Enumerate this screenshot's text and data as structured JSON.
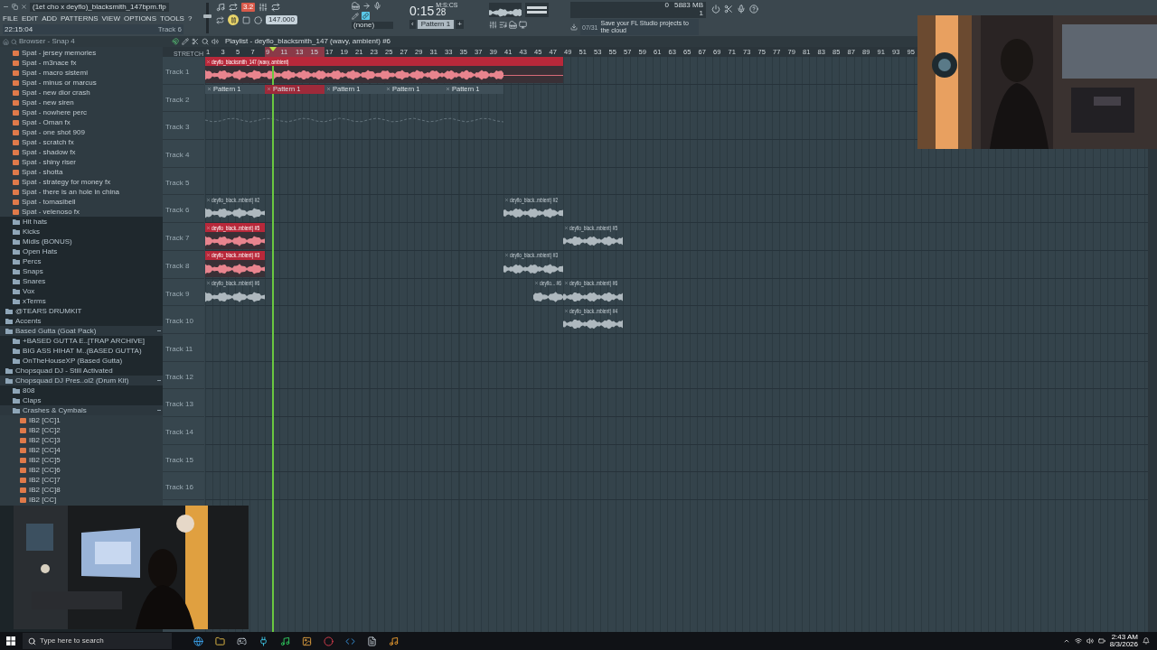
{
  "title_bar": {
    "project": "(1et cho x deyflo)_blacksmith_147bpm.flp",
    "menu": [
      "FILE",
      "EDIT",
      "ADD",
      "PATTERNS",
      "VIEW",
      "OPTIONS",
      "TOOLS",
      "?"
    ],
    "clock": "22:15:04",
    "hint": "Track 6"
  },
  "master_volume": {
    "level": 0.55
  },
  "transport": {
    "count_in": "3.2",
    "tempo": "147.000",
    "playing": true,
    "snap": "(none)"
  },
  "time_display": {
    "time": "0:15",
    "centis": "28",
    "unit": "M:S:CS"
  },
  "pattern_selector": {
    "prev": "‹",
    "label": "Pattern 1",
    "add": "+"
  },
  "monitor": {
    "cpu": "0",
    "memory": "5883 MB",
    "voices": "1"
  },
  "news": {
    "date": "07/31",
    "message": "Save your FL Studio projects to the cloud"
  },
  "browser": {
    "title": "Browser - Snap 4",
    "items": [
      {
        "kind": "file",
        "name": "Spat - jersey memories"
      },
      {
        "kind": "file",
        "name": "Spat - m3nace fx"
      },
      {
        "kind": "file",
        "name": "Spat - macro sistemi"
      },
      {
        "kind": "file",
        "name": "Spat - minus or marcus"
      },
      {
        "kind": "file",
        "name": "Spat - new dior crash"
      },
      {
        "kind": "file",
        "name": "Spat - new siren"
      },
      {
        "kind": "file",
        "name": "Spat - nowhere perc"
      },
      {
        "kind": "file",
        "name": "Spat - Oman fx"
      },
      {
        "kind": "file",
        "name": "Spat - one shot 909"
      },
      {
        "kind": "file",
        "name": "Spat - scratch fx"
      },
      {
        "kind": "file",
        "name": "Spat - shadow fx"
      },
      {
        "kind": "file",
        "name": "Spat - shiny riser"
      },
      {
        "kind": "file",
        "name": "Spat - shotta"
      },
      {
        "kind": "file",
        "name": "Spat - strategy for money fx"
      },
      {
        "kind": "file",
        "name": "Spat - there is an hole in china"
      },
      {
        "kind": "file",
        "name": "Spat - tomasibell"
      },
      {
        "kind": "file",
        "name": "Spat - velenoso fx"
      },
      {
        "kind": "folder",
        "name": "Hit hats",
        "expanded": false
      },
      {
        "kind": "folder",
        "name": "Kicks",
        "expanded": false
      },
      {
        "kind": "folder",
        "name": "Midis (BONUS)",
        "expanded": false
      },
      {
        "kind": "folder",
        "name": "Open Hats",
        "expanded": false
      },
      {
        "kind": "folder",
        "name": "Percs",
        "expanded": false
      },
      {
        "kind": "folder",
        "name": "Snaps",
        "expanded": false
      },
      {
        "kind": "folder",
        "name": "Snares",
        "expanded": false
      },
      {
        "kind": "folder",
        "name": "Vox",
        "expanded": false
      },
      {
        "kind": "folder",
        "name": "xTerms",
        "expanded": false
      }
    ],
    "tree": [
      {
        "kind": "folder",
        "name": "@TEARS DRUMKIT",
        "expanded": false
      },
      {
        "kind": "folder",
        "name": "Accents",
        "expanded": false
      },
      {
        "kind": "folder",
        "name": "Based Gutta (Goat Pack)",
        "expanded": true,
        "children": [
          {
            "kind": "folder",
            "name": "+BASED GUTTA E..[TRAP ARCHIVE]",
            "expanded": false
          },
          {
            "kind": "folder",
            "name": "BIG ASS HIHAT M..(BASED GUTTA)",
            "expanded": false
          },
          {
            "kind": "folder",
            "name": "OnTheHouseXP (Based Gutta)",
            "expanded": false
          }
        ]
      },
      {
        "kind": "folder",
        "name": "Chopsquad DJ - Still Activated",
        "expanded": false
      },
      {
        "kind": "folder",
        "name": "Chopsquad DJ Pres..ol2 (Drum Kit)",
        "expanded": true,
        "children": [
          {
            "kind": "folder",
            "name": "808",
            "expanded": false
          },
          {
            "kind": "folder",
            "name": "Claps",
            "expanded": false
          },
          {
            "kind": "folder",
            "name": "Crashes & Cymbals",
            "expanded": true,
            "children": [
              {
                "kind": "file",
                "name": "IB2 [CC]1"
              },
              {
                "kind": "file",
                "name": "IB2 [CC]2"
              },
              {
                "kind": "file",
                "name": "IB2 [CC]3"
              },
              {
                "kind": "file",
                "name": "IB2 [CC]4"
              },
              {
                "kind": "file",
                "name": "IB2 [CC]5"
              },
              {
                "kind": "file",
                "name": "IB2 [CC]6"
              },
              {
                "kind": "file",
                "name": "IB2 [CC]7"
              },
              {
                "kind": "file",
                "name": "IB2 [CC]8"
              },
              {
                "kind": "file",
                "name": "IB2 [CC]"
              }
            ]
          }
        ]
      }
    ]
  },
  "playlist": {
    "title": "Playlist - deyflo_blacksmith_147 (wavy, ambient) #6",
    "stretch_label": "STRETCH",
    "ruler": [
      "1",
      "3",
      "5",
      "7",
      "9",
      "11",
      "13",
      "15",
      "17",
      "19",
      "21",
      "23",
      "25",
      "27",
      "29",
      "31",
      "33",
      "35",
      "37",
      "39",
      "41",
      "43",
      "45",
      "47",
      "49",
      "51",
      "53",
      "55",
      "57",
      "59",
      "61",
      "63",
      "65",
      "67",
      "69",
      "71",
      "73",
      "75",
      "77",
      "79",
      "81",
      "83",
      "85",
      "87",
      "89",
      "91",
      "93",
      "95"
    ],
    "tracks": [
      {
        "name": "Track 1",
        "clips": [
          {
            "kind": "audio",
            "name": "deyflo_blacksmith_147 (wavy, ambient)",
            "selected": true
          }
        ]
      },
      {
        "name": "Track 2",
        "clips": [
          {
            "kind": "pattern",
            "name": "Pattern 1",
            "selected": false
          },
          {
            "kind": "pattern",
            "name": "Pattern 1",
            "selected": true
          },
          {
            "kind": "pattern",
            "name": "Pattern 1",
            "selected": false
          },
          {
            "kind": "pattern",
            "name": "Pattern 1",
            "selected": false
          },
          {
            "kind": "pattern",
            "name": "Pattern 1",
            "selected": false
          }
        ]
      },
      {
        "name": "Track 3",
        "clips": [
          {
            "kind": "automation"
          }
        ]
      },
      {
        "name": "Track 4"
      },
      {
        "name": "Track 5"
      },
      {
        "name": "Track 6",
        "clips": [
          {
            "kind": "audio",
            "name": "deyflo_black..mbient) #2",
            "selected": false
          },
          {
            "kind": "audio",
            "name": "deyflo_black..mbient) #2",
            "selected": false
          }
        ]
      },
      {
        "name": "Track 7",
        "clips": [
          {
            "kind": "audio",
            "name": "deyflo_black..mbient) #5",
            "selected": true
          },
          {
            "kind": "audio",
            "name": "deyflo_black..mbient) #5",
            "selected": false
          }
        ]
      },
      {
        "name": "Track 8",
        "clips": [
          {
            "kind": "audio",
            "name": "deyflo_black..mbient) #3",
            "selected": true
          },
          {
            "kind": "audio",
            "name": "deyflo_black..mbient) #3",
            "selected": false
          }
        ]
      },
      {
        "name": "Track 9",
        "clips": [
          {
            "kind": "audio",
            "name": "deyflo_black..mbient) #6",
            "selected": false
          },
          {
            "kind": "audio",
            "name": "deyflo... #6",
            "selected": false
          },
          {
            "kind": "audio",
            "name": "deyflo_black..mbient) #6",
            "selected": false
          }
        ]
      },
      {
        "name": "Track 10",
        "clips": [
          {
            "kind": "audio",
            "name": "deyflo_black..mbient) #4",
            "selected": false
          }
        ]
      },
      {
        "name": "Track 11"
      },
      {
        "name": "Track 12"
      },
      {
        "name": "Track 13"
      },
      {
        "name": "Track 14"
      },
      {
        "name": "Track 15"
      },
      {
        "name": "Track 16"
      }
    ]
  },
  "taskbar": {
    "search_placeholder": "Type here to search",
    "time": "2:43 AM",
    "date": "8/3/2026"
  }
}
